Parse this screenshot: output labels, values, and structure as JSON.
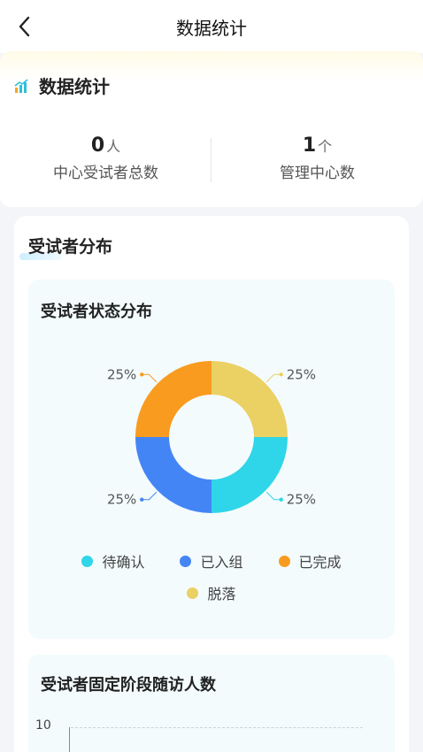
{
  "nav": {
    "title": "数据统计",
    "back_icon": "chevron-left-icon"
  },
  "stats": {
    "title": "数据统计",
    "icon": "bar-chart-icon",
    "items": [
      {
        "value": "0",
        "unit": "人",
        "label": "中心受试者总数"
      },
      {
        "value": "1",
        "unit": "个",
        "label": "管理中心数"
      }
    ]
  },
  "distribution": {
    "title": "受试者分布",
    "status_chart_title": "受试者状态分布",
    "stage_chart_title": "受试者固定阶段随访人数",
    "stage_axis_top_tick": "10"
  },
  "chart_data": [
    {
      "type": "pie",
      "title": "受试者状态分布",
      "categories": [
        "待确认",
        "已入组",
        "已完成",
        "脱落"
      ],
      "values": [
        25,
        25,
        25,
        25
      ],
      "labels": [
        "25%",
        "25%",
        "25%",
        "25%"
      ],
      "colors": [
        "#2fd5e8",
        "#4485f5",
        "#f99b1f",
        "#ebd063"
      ],
      "legend": "bottom"
    },
    {
      "type": "bar",
      "title": "受试者固定阶段随访人数",
      "y_ticks": [
        "10"
      ],
      "grid": true
    }
  ]
}
